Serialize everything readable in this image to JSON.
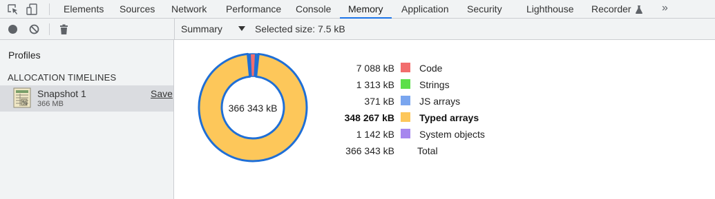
{
  "tabs": [
    {
      "label": "Elements",
      "active": false
    },
    {
      "label": "Sources",
      "active": false
    },
    {
      "label": "Network",
      "active": false
    },
    {
      "label": "Performance",
      "active": false
    },
    {
      "label": "Console",
      "active": false
    },
    {
      "label": "Memory",
      "active": true
    },
    {
      "label": "Application",
      "active": false
    },
    {
      "label": "Security",
      "active": false
    },
    {
      "label": "Lighthouse",
      "active": false
    },
    {
      "label": "Recorder",
      "active": false
    }
  ],
  "more_tabs": "»",
  "toolbar": {
    "view": "Summary",
    "selected_size": "Selected size: 7.5 kB"
  },
  "sidebar": {
    "title": "Profiles",
    "section": "ALLOCATION TIMELINES",
    "snapshot": {
      "name": "Snapshot 1",
      "size": "366 MB",
      "save_label": "Save"
    }
  },
  "chart_data": {
    "type": "pie",
    "center_label": "366 343 kB",
    "categories": [
      "Code",
      "Strings",
      "JS arrays",
      "Typed arrays",
      "System objects"
    ],
    "values": [
      7088,
      1313,
      371,
      348267,
      1142
    ],
    "value_labels": [
      "7 088 kB",
      "1 313 kB",
      "371 kB",
      "348 267 kB",
      "1 142 kB"
    ],
    "colors": [
      "#f26d6d",
      "#5cdf4a",
      "#7aa6ef",
      "#fdc75a",
      "#a687ee"
    ],
    "highlighted": "Typed arrays",
    "total": {
      "label": "Total",
      "value_label": "366 343 kB"
    },
    "donut_style": {
      "stroke": "#1f6fd6",
      "fill": "#fdc75a"
    }
  }
}
